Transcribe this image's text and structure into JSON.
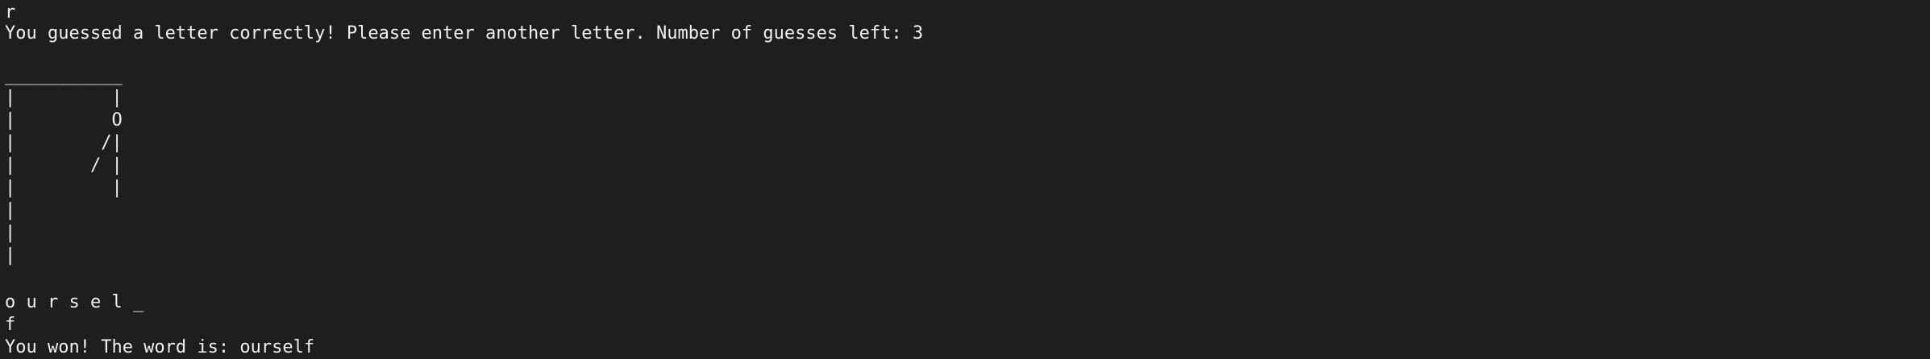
{
  "terminal": {
    "lines": [
      "r",
      "You guessed a letter correctly! Please enter another letter. Number of guesses left: 3",
      "",
      "___________",
      "|         |",
      "|         O",
      "|        /|",
      "|       / |",
      "|         |",
      "|",
      "|",
      "|",
      "",
      "o u r s e l _",
      "f",
      "You won! The word is: ourself"
    ]
  },
  "colors": {
    "background": "#1e1e1e",
    "text": "#f0f0f0"
  }
}
